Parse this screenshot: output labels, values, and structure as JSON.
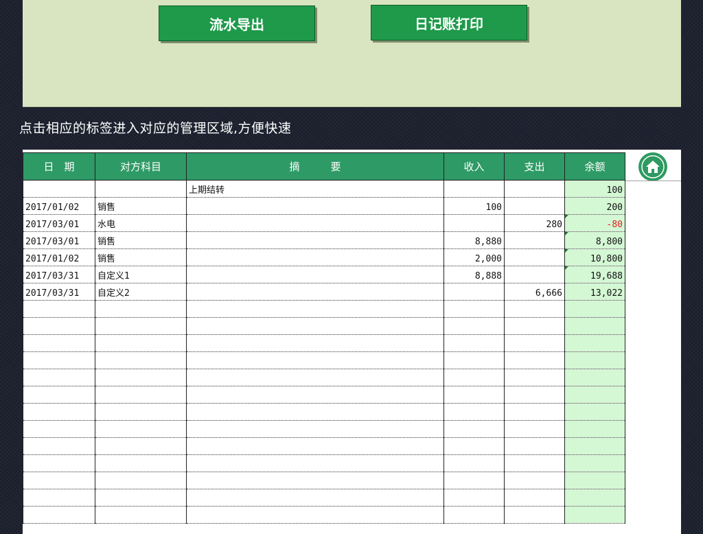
{
  "buttons": {
    "export_label": "流水导出",
    "print_label": "日记账打印"
  },
  "hint_text": "点击相应的标签进入对应的管理区域,方便快速",
  "ledger": {
    "headers": {
      "date": "日　期",
      "account": "对方科目",
      "summary": "摘　　　要",
      "income": "收入",
      "expense": "支出",
      "balance": "余额"
    },
    "rows": [
      {
        "date": "",
        "account": "",
        "summary": "上期结转",
        "income": "",
        "expense": "",
        "balance": "100"
      },
      {
        "date": "2017/01/02",
        "account": "销售",
        "summary": "",
        "income": "100",
        "expense": "",
        "balance": "200"
      },
      {
        "date": "2017/03/01",
        "account": "水电",
        "summary": "",
        "income": "",
        "expense": "280",
        "balance": "-80"
      },
      {
        "date": "2017/03/01",
        "account": "销售",
        "summary": "",
        "income": "8,880",
        "expense": "",
        "balance": "8,800"
      },
      {
        "date": "2017/01/02",
        "account": "销售",
        "summary": "",
        "income": "2,000",
        "expense": "",
        "balance": "10,800"
      },
      {
        "date": "2017/03/31",
        "account": "自定义1",
        "summary": "",
        "income": "8,888",
        "expense": "",
        "balance": "19,688"
      },
      {
        "date": "2017/03/31",
        "account": "自定义2",
        "summary": "",
        "income": "",
        "expense": "6,666",
        "balance": "13,022"
      }
    ],
    "empty_rows": 13
  },
  "icons": {
    "home": "home-icon"
  },
  "colors": {
    "header_green": "#2e9a66",
    "button_green": "#1e9a4a",
    "panel": "#d9e5c0",
    "balance_fill": "#d4f7d4",
    "negative": "#e02020"
  }
}
